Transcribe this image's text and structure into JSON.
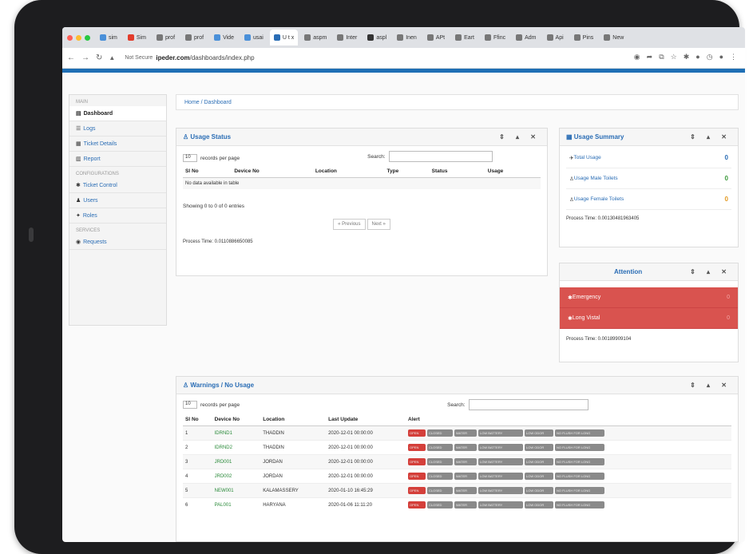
{
  "browser": {
    "tabs": [
      "sim",
      "Sim",
      "prof",
      "prof",
      "Vide",
      "usai",
      "U  t  x",
      "aspm",
      "Inter",
      "aspl",
      "Inen",
      "APt",
      "Eart",
      "Ffinc",
      "Adm",
      "Api",
      "Pins",
      "New"
    ],
    "url_security": "Not Secure",
    "url_host": "ipeder.com",
    "url_path": "/dashboards/index.php"
  },
  "breadcrumb": "Home  /  Dashboard",
  "sidebar": {
    "sections": [
      {
        "title": "main",
        "items": [
          {
            "label": "Dashboard",
            "icon": "dashboard-icon",
            "active": true
          },
          {
            "label": "Logs",
            "icon": "list-icon"
          },
          {
            "label": "Ticket Details",
            "icon": "ticket-icon"
          },
          {
            "label": "Report",
            "icon": "report-icon"
          }
        ]
      },
      {
        "title": "Configurations",
        "items": [
          {
            "label": "Ticket Control",
            "icon": "gear-icon"
          },
          {
            "label": "Users",
            "icon": "user-icon"
          },
          {
            "label": "Roles",
            "icon": "roles-icon"
          }
        ]
      },
      {
        "title": "Services",
        "items": [
          {
            "label": "Requests",
            "icon": "request-icon"
          }
        ]
      }
    ]
  },
  "usage_status": {
    "title": "Usage Status",
    "len_value": "10",
    "len_label": "records per page",
    "search_label": "Search:",
    "columns": [
      "Sl No",
      "Device No",
      "Location",
      "Type",
      "Status",
      "Usage"
    ],
    "empty_text": "No data available in table",
    "info": "Showing 0 to 0 of 0 entries",
    "prev": "« Previous",
    "next": "Next »",
    "process_time": "Process Time: 0.0110886650085"
  },
  "usage_summary": {
    "title": "Usage Summary",
    "rows": [
      {
        "label": "Total Usage",
        "count": "0",
        "color": "#2a6db5"
      },
      {
        "label": "Usage Male Toilets",
        "count": "0",
        "color": "#3c9a3c"
      },
      {
        "label": "Usage Female Toilets",
        "count": "0",
        "color": "#e39a22"
      }
    ],
    "process_time": "Process Time: 0.00130481963405"
  },
  "attention": {
    "title": "Attention",
    "rows": [
      {
        "label": "Emergency",
        "count": "0"
      },
      {
        "label": "Long Vistal",
        "count": "0"
      }
    ],
    "process_time": "Process Time: 0.00189909104"
  },
  "warnings": {
    "title": "Warnings / No Usage",
    "len_value": "10",
    "len_label": "records per page",
    "search_label": "Search:",
    "columns": [
      "Sl No",
      "Device No",
      "Location",
      "Last Update",
      "Alert"
    ],
    "rows": [
      {
        "sl": "1",
        "device": "IDRND1",
        "location": "THADDIN",
        "updated": "2020-12-01 00:00:00"
      },
      {
        "sl": "2",
        "device": "IDRND2",
        "location": "THADDIN",
        "updated": "2020-12-01 00:00:00"
      },
      {
        "sl": "3",
        "device": "JRD001",
        "location": "JORDAN",
        "updated": "2020-12-01 00:00:00"
      },
      {
        "sl": "4",
        "device": "JRD002",
        "location": "JORDAN",
        "updated": "2020-12-01 00:00:00"
      },
      {
        "sl": "5",
        "device": "NEW001",
        "location": "KALAMASSERY",
        "updated": "2020-01-10 16:45:29"
      },
      {
        "sl": "6",
        "device": "PAL001",
        "location": "HARYANA",
        "updated": "2020-01-06 11:11:20"
      }
    ],
    "alert_labels": [
      "OPEN",
      "CLOSED",
      "WATER",
      "LOW BATTERY",
      "LOW ODOR",
      "NO FLUSH FOR LONG"
    ]
  }
}
